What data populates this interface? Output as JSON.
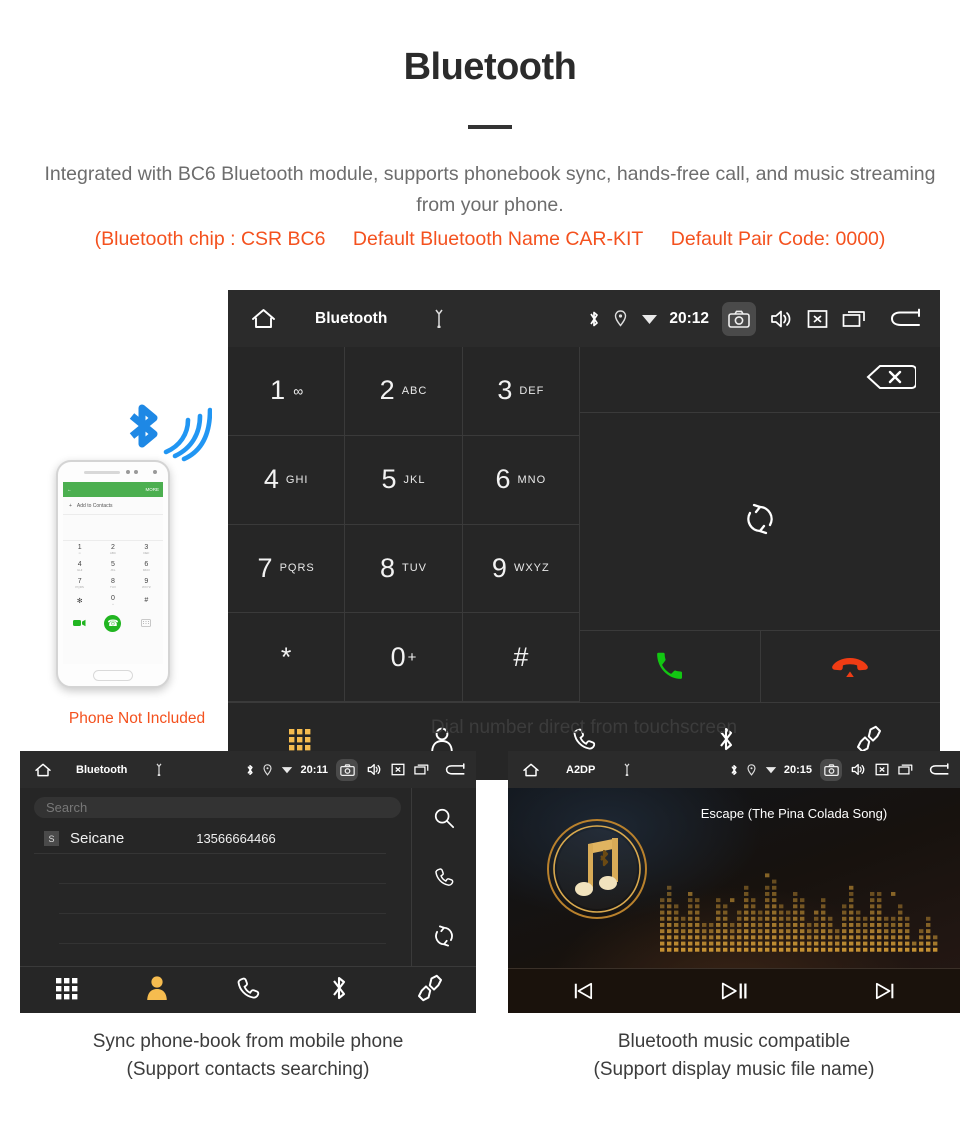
{
  "header": {
    "title": "Bluetooth",
    "subtitle": "Integrated with BC6 Bluetooth module, supports phonebook sync, hands-free call, and music streaming from your phone.",
    "specs": [
      "(Bluetooth chip : CSR BC6",
      "Default Bluetooth Name CAR-KIT",
      "Default Pair Code: 0000)"
    ],
    "accent_color": "#f4511e",
    "title_color": "#2b2b2b"
  },
  "dialer": {
    "statusbar": {
      "home_icon": "home-icon",
      "title": "Bluetooth",
      "usb_icon": "usb-icon",
      "bluetooth_icon": "bluetooth-icon",
      "location_icon": "location-pin-icon",
      "wifi_icon": "wifi-icon",
      "time": "20:12",
      "camera_icon": "camera-icon",
      "volume_icon": "volume-icon",
      "close_icon": "close-box-icon",
      "recents_icon": "recents-icon",
      "back_icon": "back-icon"
    },
    "keys": [
      {
        "num": "1",
        "sub": "",
        "vm": "∞"
      },
      {
        "num": "2",
        "sub": "ABC",
        "vm": ""
      },
      {
        "num": "3",
        "sub": "DEF",
        "vm": ""
      },
      {
        "num": "4",
        "sub": "GHI",
        "vm": ""
      },
      {
        "num": "5",
        "sub": "JKL",
        "vm": ""
      },
      {
        "num": "6",
        "sub": "MNO",
        "vm": ""
      },
      {
        "num": "7",
        "sub": "PQRS",
        "vm": ""
      },
      {
        "num": "8",
        "sub": "TUV",
        "vm": ""
      },
      {
        "num": "9",
        "sub": "WXYZ",
        "vm": ""
      },
      {
        "num": "*",
        "sub": "",
        "vm": ""
      },
      {
        "num": "0",
        "sub": "",
        "vm": "+"
      },
      {
        "num": "#",
        "sub": "",
        "vm": ""
      }
    ],
    "number_display": "",
    "backspace_icon": "backspace-icon",
    "sync_icon": "sync-icon",
    "call_icon": "call-icon",
    "call_color": "#12c712",
    "hangup_icon": "hangup-icon",
    "hangup_color": "#f03c14",
    "tabs": [
      {
        "name": "keypad",
        "icon": "keypad-icon",
        "active": true
      },
      {
        "name": "contacts",
        "icon": "person-icon",
        "active": false
      },
      {
        "name": "call-log",
        "icon": "phone-handset-icon",
        "active": false
      },
      {
        "name": "bluetooth",
        "icon": "bluetooth-icon",
        "active": false
      },
      {
        "name": "pair",
        "icon": "link-icon",
        "active": false
      }
    ],
    "active_tab_color": "#f6bc4f",
    "caption": "Dial number direct from touchscreen"
  },
  "phone_illustration": {
    "app_bar_back": "←",
    "app_bar_more": "MORE",
    "add_contact_label": "Add to Contacts",
    "keys": [
      {
        "num": "1",
        "sub": "∞"
      },
      {
        "num": "2",
        "sub": "ABC"
      },
      {
        "num": "3",
        "sub": "DEF"
      },
      {
        "num": "4",
        "sub": "GHI"
      },
      {
        "num": "5",
        "sub": "JKL"
      },
      {
        "num": "6",
        "sub": "MNO"
      },
      {
        "num": "7",
        "sub": "PQRS"
      },
      {
        "num": "8",
        "sub": "TUV"
      },
      {
        "num": "9",
        "sub": "WXYZ"
      },
      {
        "num": "✻",
        "sub": ""
      },
      {
        "num": "0",
        "sub": "+"
      },
      {
        "num": "#",
        "sub": ""
      }
    ],
    "call_icon": "call-icon",
    "video_icon": "video-call-icon",
    "keyboard_icon": "keyboard-icon",
    "disclaimer": "Phone Not Included",
    "disclaimer_color": "#f4511e",
    "bluetooth_wave_color": "#2196f3"
  },
  "phonebook": {
    "statusbar": {
      "title": "Bluetooth",
      "time": "20:11"
    },
    "search_placeholder": "Search",
    "contacts": [
      {
        "badge": "S",
        "name": "Seicane",
        "number": "13566664466"
      }
    ],
    "side_actions": [
      {
        "name": "search",
        "icon": "search-icon"
      },
      {
        "name": "dial",
        "icon": "phone-handset-icon"
      },
      {
        "name": "sync",
        "icon": "sync-icon"
      }
    ],
    "tabs": [
      {
        "name": "keypad",
        "icon": "keypad-icon",
        "active": false
      },
      {
        "name": "contacts",
        "icon": "person-icon",
        "active": true
      },
      {
        "name": "call-log",
        "icon": "phone-handset-icon",
        "active": false
      },
      {
        "name": "bluetooth",
        "icon": "bluetooth-icon",
        "active": false
      },
      {
        "name": "pair",
        "icon": "link-icon",
        "active": false
      }
    ],
    "caption_line1": "Sync phone-book from mobile phone",
    "caption_line2": "(Support contacts searching)"
  },
  "music": {
    "statusbar": {
      "title": "A2DP",
      "time": "20:15"
    },
    "song_title": "Escape (The Pina Colada Song)",
    "album_art_icon": "music-note-bluetooth-icon",
    "album_art_color": "#d6a44a",
    "controls": [
      {
        "name": "previous",
        "icon": "skip-previous-icon"
      },
      {
        "name": "play-pause",
        "icon": "play-pause-icon"
      },
      {
        "name": "next",
        "icon": "skip-next-icon"
      }
    ],
    "caption_line1": "Bluetooth music compatible",
    "caption_line2": "(Support display music file name)"
  }
}
